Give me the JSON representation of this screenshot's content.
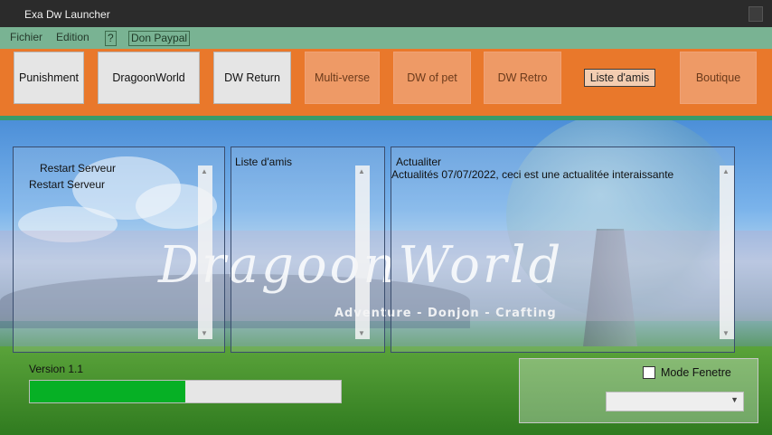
{
  "window": {
    "title": "Exa Dw Launcher"
  },
  "menu": {
    "items": [
      {
        "label": "Fichier"
      },
      {
        "label": "Edition"
      },
      {
        "label": "?"
      },
      {
        "label": "Don Paypal"
      }
    ]
  },
  "toolbar": {
    "buttons": [
      {
        "label": "Punishment"
      },
      {
        "label": "DragoonWorld"
      },
      {
        "label": "DW Return"
      },
      {
        "label": "Multi-verse"
      },
      {
        "label": "DW of pet"
      },
      {
        "label": "DW Retro"
      },
      {
        "label": "Liste d'amis"
      },
      {
        "label": "Boutique"
      }
    ]
  },
  "banner": {
    "logo_text": "DragoonWorld",
    "tagline": "Adventure - Donjon - Crafting"
  },
  "panels": {
    "servers": {
      "lines": [
        "Restart Serveur",
        "Restart Serveur"
      ]
    },
    "friends": {
      "title": "Liste d'amis"
    },
    "news": {
      "title": "Actualiter",
      "text": "Actualités 07/07/2022, ceci est une actualitée interaissante"
    }
  },
  "footer": {
    "version": "Version 1.1",
    "progress": 0.5,
    "window_mode_label": "Mode Fenetre",
    "window_mode_checked": false,
    "combo_value": ""
  },
  "colors": {
    "menubar": "#79b393",
    "toolbar": "#e9782b",
    "progress_fill": "#06b025"
  }
}
